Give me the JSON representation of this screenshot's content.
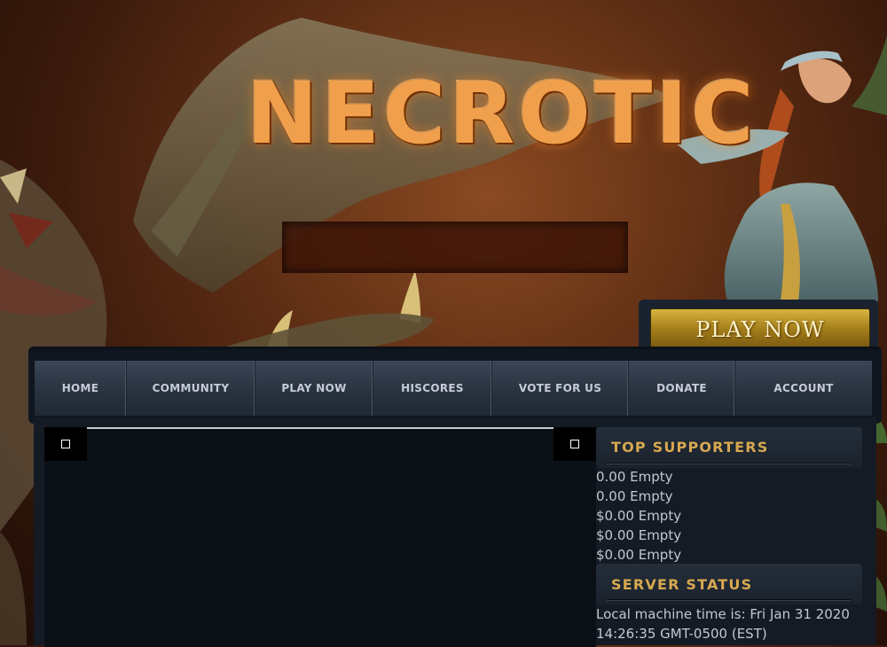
{
  "header": {
    "logo_text": "NECROTIC",
    "play_button_label": "PLAY NOW"
  },
  "nav": {
    "items": [
      {
        "label": "HOME"
      },
      {
        "label": "COMMUNITY"
      },
      {
        "label": "PLAY NOW"
      },
      {
        "label": "HISCORES"
      },
      {
        "label": "VOTE FOR US"
      },
      {
        "label": "DONATE"
      },
      {
        "label": "ACCOUNT"
      }
    ]
  },
  "top_supporters": {
    "title": "TOP SUPPORTERS",
    "entries": [
      "0.00 Empty",
      "0.00 Empty",
      "$0.00 Empty",
      "$0.00 Empty",
      "$0.00 Empty"
    ]
  },
  "server_status": {
    "title": "SERVER STATUS",
    "line1": "Local machine time is:  Fri Jan 31 2020",
    "line2": "14:26:35 GMT-0500 (EST)"
  },
  "colors": {
    "accent_gold": "#d8a850",
    "logo_orange": "#f0a04c",
    "nav_bg": "#2a3442",
    "panel_bg": "#0b1016"
  },
  "icons": {
    "corner_left": "square-icon",
    "corner_right": "square-icon"
  }
}
